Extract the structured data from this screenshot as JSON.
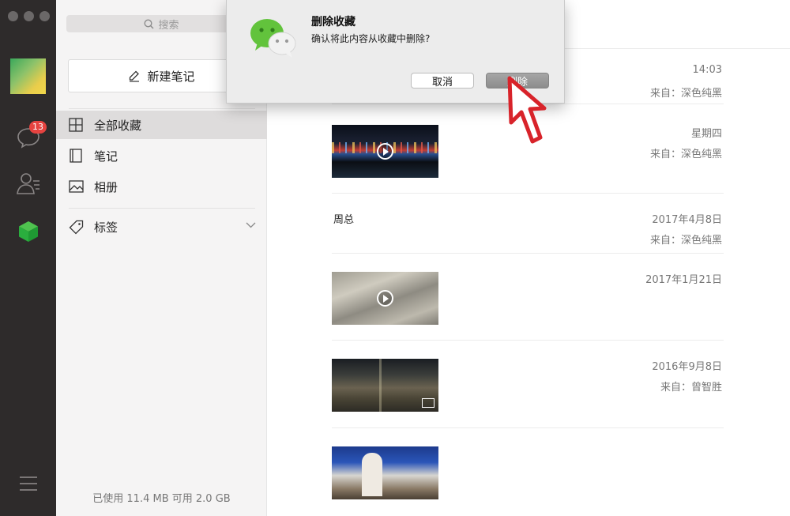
{
  "sidebar": {
    "badge_count": "13"
  },
  "panel": {
    "search_placeholder": "搜索",
    "new_note_label": "新建笔记",
    "nav": [
      {
        "label": "全部收藏",
        "active": true
      },
      {
        "label": "笔记",
        "active": false
      },
      {
        "label": "相册",
        "active": false
      }
    ],
    "tags_label": "标签",
    "storage": "已使用 11.4 MB 可用 2.0 GB"
  },
  "main": {
    "entries": [
      {
        "title": "",
        "date": "14:03",
        "from": "来自：深色纯黑",
        "media": "none"
      },
      {
        "title": "",
        "date": "星期四",
        "from": "来自：深色纯黑",
        "media": "video-night-city"
      },
      {
        "title": "周总",
        "date": "2017年4月8日",
        "from": "来自：深色纯黑",
        "media": "none"
      },
      {
        "title": "",
        "date": "2017年1月21日",
        "from": "",
        "media": "video-blur"
      },
      {
        "title": "",
        "date": "2016年9月8日",
        "from": "来自：曾智胜",
        "media": "photo-street-night"
      },
      {
        "title": "",
        "date": "",
        "from": "",
        "media": "photo-office"
      }
    ]
  },
  "dialog": {
    "title": "删除收藏",
    "message": "确认将此内容从收藏中删除?",
    "cancel_label": "取消",
    "delete_label": "删除"
  },
  "colors": {
    "sidebar_bg": "#2e2b2b",
    "accent_green": "#2aae3e",
    "badge_red": "#e64340",
    "cursor_red": "#d8232a"
  }
}
